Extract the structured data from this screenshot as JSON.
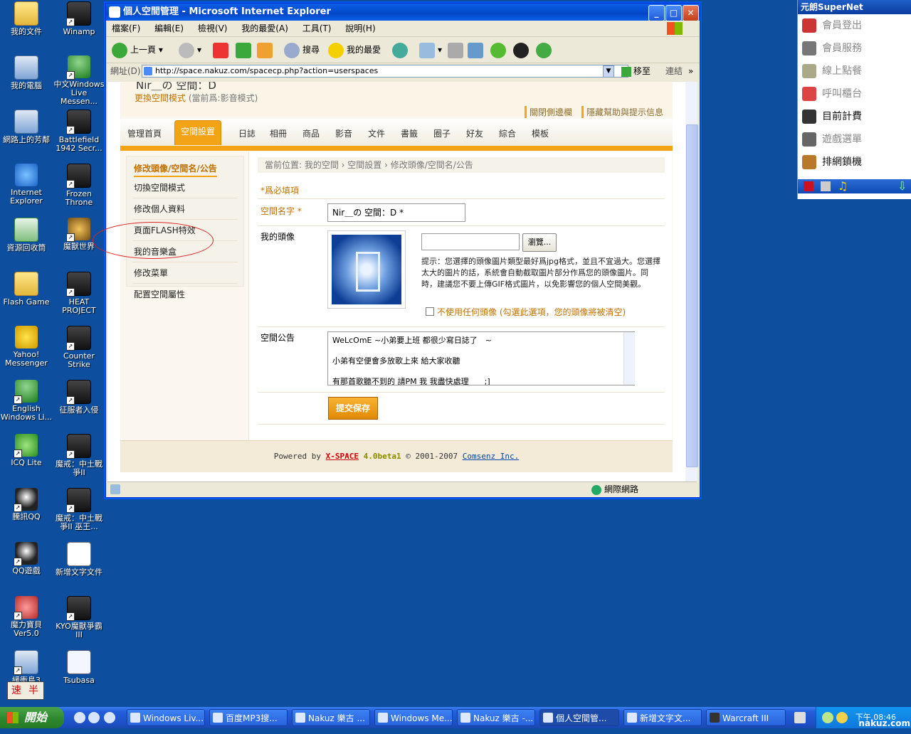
{
  "desktop": {
    "icons": [
      {
        "label": "我的文件",
        "icon": "folder-icon"
      },
      {
        "label": "Winamp",
        "icon": "winamp-icon"
      },
      {
        "label": "我的電腦",
        "icon": "computer-icon"
      },
      {
        "label": "中文Windows Live Messen...",
        "icon": "messenger-icon"
      },
      {
        "label": "網路上的芳鄰",
        "icon": "network-icon"
      },
      {
        "label": "Battlefield 1942 Secr...",
        "icon": "battlefield-icon"
      },
      {
        "label": "Internet Explorer",
        "icon": "ie-icon"
      },
      {
        "label": "Frozen Throne",
        "icon": "frozen-throne-icon"
      },
      {
        "label": "資源回收筒",
        "icon": "recycle-bin-icon"
      },
      {
        "label": "魔獸世界",
        "icon": "wow-icon"
      },
      {
        "label": "Flash Game",
        "icon": "folder-icon"
      },
      {
        "label": "HEAT PROJECT",
        "icon": "heat-project-icon"
      },
      {
        "label": "Yahoo! Messenger",
        "icon": "yahoo-icon"
      },
      {
        "label": "Counter Strike",
        "icon": "counter-strike-icon"
      },
      {
        "label": "English Windows Li...",
        "icon": "messenger-icon"
      },
      {
        "label": "征服者入侵",
        "icon": "game-icon"
      },
      {
        "label": "ICQ Lite",
        "icon": "icq-icon"
      },
      {
        "label": "魔戒：中土戰爭II",
        "icon": "game-icon"
      },
      {
        "label": "騰訊QQ",
        "icon": "qq-icon"
      },
      {
        "label": "魔戒：中土戰爭II 巫王...",
        "icon": "game-icon"
      },
      {
        "label": "QQ遊戲",
        "icon": "qq-game-icon"
      },
      {
        "label": "新增文字文件",
        "icon": "text-file-icon"
      },
      {
        "label": "魔力寶貝 Ver5.0",
        "icon": "game-icon"
      },
      {
        "label": "KYO魔獸爭霸III",
        "icon": "game-icon"
      },
      {
        "label": "緩衝島3",
        "icon": "game-icon"
      },
      {
        "label": "Tsubasa",
        "icon": "mp3-file-icon"
      }
    ],
    "ime": {
      "left": "速",
      "right": "半"
    }
  },
  "browser": {
    "title": "個人空間管理 - Microsoft Internet Explorer",
    "menu": [
      "檔案(F)",
      "編輯(E)",
      "檢視(V)",
      "我的最愛(A)",
      "工具(T)",
      "說明(H)"
    ],
    "toolbar": {
      "back": "上一頁",
      "search": "搜尋",
      "favorites": "我的最愛"
    },
    "address_label": "網址(D)",
    "url": "http://space.nakuz.com/spacecp.php?action=userspaces",
    "go": "移至",
    "links": "連結",
    "status_zone": "網際網路"
  },
  "page": {
    "old_title": "Nir＿の 空間：D",
    "mode_link": "更換空間模式",
    "mode_note": "(當前爲:影音模式)",
    "top_links": [
      "關閉側邊欄",
      "隱藏幫助與提示信息"
    ],
    "tabs": [
      "管理首頁",
      "空間設置",
      "日誌",
      "相冊",
      "商品",
      "影音",
      "文件",
      "書籤",
      "圈子",
      "好友",
      "綜合",
      "模板"
    ],
    "active_tab": "空間設置",
    "sidebar": {
      "title": "修改頭像/空間名/公告",
      "items": [
        "切換空間模式",
        "修改個人資料",
        "頁面FLASH特效",
        "我的音樂盒",
        "修改菜單",
        "配置空間屬性"
      ]
    },
    "breadcrumb": "當前位置: 我的空間 › 空間設置 › 修改頭像/空間名/公告",
    "required_note": "*爲必填項",
    "form": {
      "name_label": "空間名字 *",
      "name_value": "Nir＿の 空間：D *",
      "avatar_label": "我的頭像",
      "browse": "瀏覽...",
      "hint": "提示：您選擇的頭像圖片類型最好爲jpg格式，並且不宜過大。您選擇太大的圖片的話，系統會自動截取圖片部分作爲您的頭像圖片。同時，建議您不要上傳GIF格式圖片，以免影響您的個人空間美觀。",
      "no_avatar": "不使用任何頭像 (勾選此選項，您的頭像將被清空)",
      "announce_label": "空間公告",
      "announce_lines": [
        "WeLcOmE ~小弟要上班 都很少寫日誌了　~",
        "小弟有空便會多放歌上來 給大家收聽",
        "有那首歌聽不到的 請PM 我 我盡快處理　　;]"
      ],
      "submit": "提交保存"
    },
    "footer": {
      "powered": "Powered by",
      "brand": "X-SPACE",
      "version": "4.0beta1",
      "copyright": "© 2001-2007",
      "company": "Comsenz Inc."
    }
  },
  "supernet": {
    "title": "元朗SuperNet",
    "items": [
      {
        "label": "會員登出",
        "icon": "logout-icon"
      },
      {
        "label": "會員服務",
        "icon": "member-card-icon"
      },
      {
        "label": "線上點餐",
        "icon": "clipboard-icon"
      },
      {
        "label": "呼叫櫃台",
        "icon": "phone-icon"
      },
      {
        "label": "目前計費",
        "icon": "clock-icon"
      },
      {
        "label": "遊戲選單",
        "icon": "joystick-icon"
      },
      {
        "label": "排網鎖機",
        "icon": "lock-icon"
      }
    ]
  },
  "taskbar": {
    "start": "開始",
    "tasks": [
      {
        "label": "Windows Liv...",
        "active": false
      },
      {
        "label": "百度MP3搜...",
        "active": false
      },
      {
        "label": "Nakuz 樂古 ...",
        "active": false
      },
      {
        "label": "Windows Me...",
        "active": false
      },
      {
        "label": "Nakuz 樂古 -...",
        "active": false
      },
      {
        "label": "個人空間管...",
        "active": true
      },
      {
        "label": "新增文字文...",
        "active": false
      },
      {
        "label": "Warcraft III",
        "active": false
      }
    ],
    "clock": "下午 08:46",
    "watermark": "nakuz.com"
  }
}
